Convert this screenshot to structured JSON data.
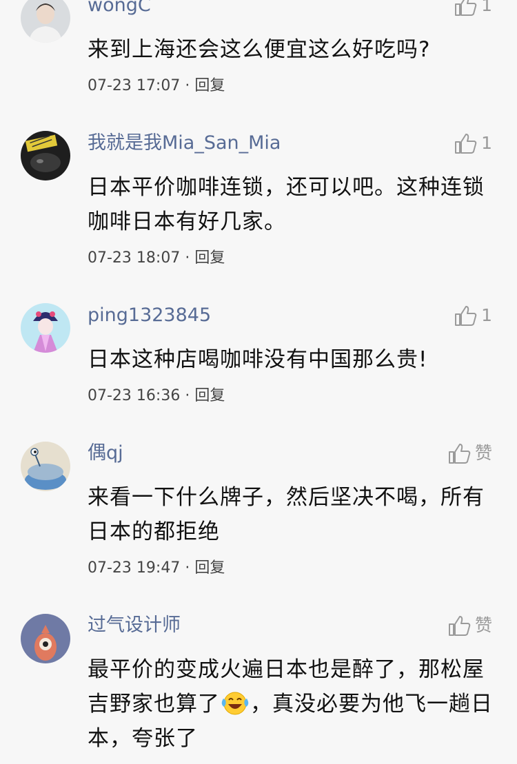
{
  "comments": [
    {
      "username": "wongC",
      "like_count": "1",
      "text": "来到上海还会这么便宜这么好吃吗?",
      "time": "07-23 17:07",
      "reply_label": "回复"
    },
    {
      "username": "我就是我Mia_San_Mia",
      "like_count": "1",
      "text": "日本平价咖啡连锁，还可以吧。这种连锁咖啡日本有好几家。",
      "time": "07-23 18:07",
      "reply_label": "回复"
    },
    {
      "username": "ping1323845",
      "like_count": "1",
      "text": "日本这种店喝咖啡没有中国那么贵!",
      "time": "07-23 16:36",
      "reply_label": "回复"
    },
    {
      "username": "偶qj",
      "like_count": "赞",
      "text": "来看一下什么牌子，然后坚决不喝，所有日本的都拒绝",
      "time": "07-23 19:47",
      "reply_label": "回复"
    },
    {
      "username": "过气设计师",
      "like_count": "赞",
      "text_part1": "最平价的变成火遍日本也是醉了，那松屋吉野家也算了",
      "text_part2": "，真没必要为他飞一趟日本，夸张了"
    }
  ],
  "meta_separator": " · ",
  "icons": {
    "like": "thumbs-up-icon",
    "emoji": "laughing-crying-emoji"
  },
  "colors": {
    "username": "#576b95",
    "background": "#f7f7f7",
    "secondary_text": "#9a9a9a"
  }
}
